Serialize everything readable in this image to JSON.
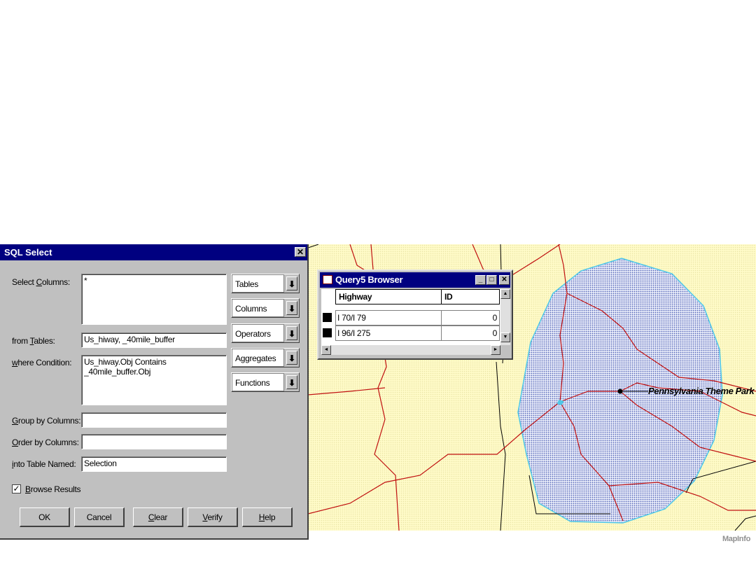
{
  "sql_dialog": {
    "title": "SQL Select",
    "close_glyph": "✕",
    "labels": {
      "select_columns_pre": "Select ",
      "select_columns_u": "C",
      "select_columns_post": "olumns:",
      "from_tables_pre": "from ",
      "from_tables_u": "T",
      "from_tables_post": "ables:",
      "where_u": "w",
      "where_post": "here Condition:",
      "group_u": "G",
      "group_post": "roup by Columns:",
      "order_u": "O",
      "order_post": "rder by Columns:",
      "into_u": "i",
      "into_post": "nto Table Named:",
      "browse_u": "B",
      "browse_post": "rowse Results"
    },
    "fields": {
      "select_columns": "*",
      "from_tables": "Us_hiway, _40mile_buffer",
      "where_condition": "Us_hiway.Obj Contains\n_40mile_buffer.Obj",
      "group_by": "",
      "order_by": "",
      "into_table": "Selection"
    },
    "browse_results_checked": true,
    "check_glyph": "✓",
    "dropdowns": [
      "Tables",
      "Columns",
      "Operators",
      "Aggregates",
      "Functions"
    ],
    "dropdown_glyph": "⬇",
    "buttons": {
      "ok": "OK",
      "cancel": "Cancel",
      "clear_u": "C",
      "clear_post": "lear",
      "verify_u": "V",
      "verify_post": "erify",
      "help_u": "H",
      "help_post": "elp"
    }
  },
  "query_browser": {
    "title": "Query5 Browser",
    "window_glyphs": [
      "_",
      "□",
      "✕"
    ],
    "columns": [
      "Highway",
      "ID"
    ],
    "rows": [
      {
        "highway": "I 70/I 79",
        "id": "0"
      },
      {
        "highway": "I 96/I 275",
        "id": "0"
      }
    ],
    "scroll_glyphs": {
      "up": "▲",
      "down": "▼",
      "left": "◄",
      "right": "►"
    }
  },
  "map": {
    "label": "Pennsylvania Theme Park",
    "colors": {
      "background": "#fffbc8",
      "buffer_fill": "#b8c8f0",
      "buffer_edge": "#4dc8e8",
      "roads": "#c01010",
      "boundaries": "#000000"
    }
  },
  "footer": {
    "brand": "MapInfo"
  }
}
